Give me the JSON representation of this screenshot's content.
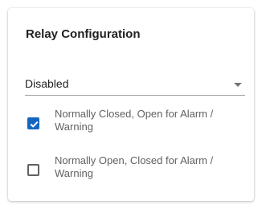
{
  "card": {
    "title": "Relay Configuration"
  },
  "select": {
    "value": "Disabled",
    "arrow_icon": "dropdown-arrow-icon"
  },
  "options": [
    {
      "label": "Normally Closed, Open for Alarm / Warning",
      "checked": true
    },
    {
      "label": "Normally Open, Closed for Alarm / Warning",
      "checked": false
    }
  ],
  "colors": {
    "accent": "#1565c0",
    "text_primary": "#212121",
    "text_secondary": "#616161"
  }
}
